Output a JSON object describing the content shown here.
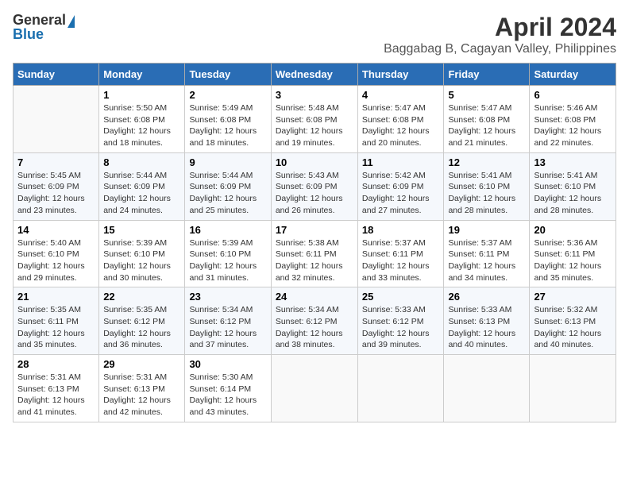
{
  "header": {
    "logo_general": "General",
    "logo_blue": "Blue",
    "month": "April 2024",
    "location": "Baggabag B, Cagayan Valley, Philippines"
  },
  "columns": [
    "Sunday",
    "Monday",
    "Tuesday",
    "Wednesday",
    "Thursday",
    "Friday",
    "Saturday"
  ],
  "weeks": [
    [
      {
        "day": "",
        "info": ""
      },
      {
        "day": "1",
        "info": "Sunrise: 5:50 AM\nSunset: 6:08 PM\nDaylight: 12 hours\nand 18 minutes."
      },
      {
        "day": "2",
        "info": "Sunrise: 5:49 AM\nSunset: 6:08 PM\nDaylight: 12 hours\nand 18 minutes."
      },
      {
        "day": "3",
        "info": "Sunrise: 5:48 AM\nSunset: 6:08 PM\nDaylight: 12 hours\nand 19 minutes."
      },
      {
        "day": "4",
        "info": "Sunrise: 5:47 AM\nSunset: 6:08 PM\nDaylight: 12 hours\nand 20 minutes."
      },
      {
        "day": "5",
        "info": "Sunrise: 5:47 AM\nSunset: 6:08 PM\nDaylight: 12 hours\nand 21 minutes."
      },
      {
        "day": "6",
        "info": "Sunrise: 5:46 AM\nSunset: 6:08 PM\nDaylight: 12 hours\nand 22 minutes."
      }
    ],
    [
      {
        "day": "7",
        "info": "Sunrise: 5:45 AM\nSunset: 6:09 PM\nDaylight: 12 hours\nand 23 minutes."
      },
      {
        "day": "8",
        "info": "Sunrise: 5:44 AM\nSunset: 6:09 PM\nDaylight: 12 hours\nand 24 minutes."
      },
      {
        "day": "9",
        "info": "Sunrise: 5:44 AM\nSunset: 6:09 PM\nDaylight: 12 hours\nand 25 minutes."
      },
      {
        "day": "10",
        "info": "Sunrise: 5:43 AM\nSunset: 6:09 PM\nDaylight: 12 hours\nand 26 minutes."
      },
      {
        "day": "11",
        "info": "Sunrise: 5:42 AM\nSunset: 6:09 PM\nDaylight: 12 hours\nand 27 minutes."
      },
      {
        "day": "12",
        "info": "Sunrise: 5:41 AM\nSunset: 6:10 PM\nDaylight: 12 hours\nand 28 minutes."
      },
      {
        "day": "13",
        "info": "Sunrise: 5:41 AM\nSunset: 6:10 PM\nDaylight: 12 hours\nand 28 minutes."
      }
    ],
    [
      {
        "day": "14",
        "info": "Sunrise: 5:40 AM\nSunset: 6:10 PM\nDaylight: 12 hours\nand 29 minutes."
      },
      {
        "day": "15",
        "info": "Sunrise: 5:39 AM\nSunset: 6:10 PM\nDaylight: 12 hours\nand 30 minutes."
      },
      {
        "day": "16",
        "info": "Sunrise: 5:39 AM\nSunset: 6:10 PM\nDaylight: 12 hours\nand 31 minutes."
      },
      {
        "day": "17",
        "info": "Sunrise: 5:38 AM\nSunset: 6:11 PM\nDaylight: 12 hours\nand 32 minutes."
      },
      {
        "day": "18",
        "info": "Sunrise: 5:37 AM\nSunset: 6:11 PM\nDaylight: 12 hours\nand 33 minutes."
      },
      {
        "day": "19",
        "info": "Sunrise: 5:37 AM\nSunset: 6:11 PM\nDaylight: 12 hours\nand 34 minutes."
      },
      {
        "day": "20",
        "info": "Sunrise: 5:36 AM\nSunset: 6:11 PM\nDaylight: 12 hours\nand 35 minutes."
      }
    ],
    [
      {
        "day": "21",
        "info": "Sunrise: 5:35 AM\nSunset: 6:11 PM\nDaylight: 12 hours\nand 35 minutes."
      },
      {
        "day": "22",
        "info": "Sunrise: 5:35 AM\nSunset: 6:12 PM\nDaylight: 12 hours\nand 36 minutes."
      },
      {
        "day": "23",
        "info": "Sunrise: 5:34 AM\nSunset: 6:12 PM\nDaylight: 12 hours\nand 37 minutes."
      },
      {
        "day": "24",
        "info": "Sunrise: 5:34 AM\nSunset: 6:12 PM\nDaylight: 12 hours\nand 38 minutes."
      },
      {
        "day": "25",
        "info": "Sunrise: 5:33 AM\nSunset: 6:12 PM\nDaylight: 12 hours\nand 39 minutes."
      },
      {
        "day": "26",
        "info": "Sunrise: 5:33 AM\nSunset: 6:13 PM\nDaylight: 12 hours\nand 40 minutes."
      },
      {
        "day": "27",
        "info": "Sunrise: 5:32 AM\nSunset: 6:13 PM\nDaylight: 12 hours\nand 40 minutes."
      }
    ],
    [
      {
        "day": "28",
        "info": "Sunrise: 5:31 AM\nSunset: 6:13 PM\nDaylight: 12 hours\nand 41 minutes."
      },
      {
        "day": "29",
        "info": "Sunrise: 5:31 AM\nSunset: 6:13 PM\nDaylight: 12 hours\nand 42 minutes."
      },
      {
        "day": "30",
        "info": "Sunrise: 5:30 AM\nSunset: 6:14 PM\nDaylight: 12 hours\nand 43 minutes."
      },
      {
        "day": "",
        "info": ""
      },
      {
        "day": "",
        "info": ""
      },
      {
        "day": "",
        "info": ""
      },
      {
        "day": "",
        "info": ""
      }
    ]
  ]
}
